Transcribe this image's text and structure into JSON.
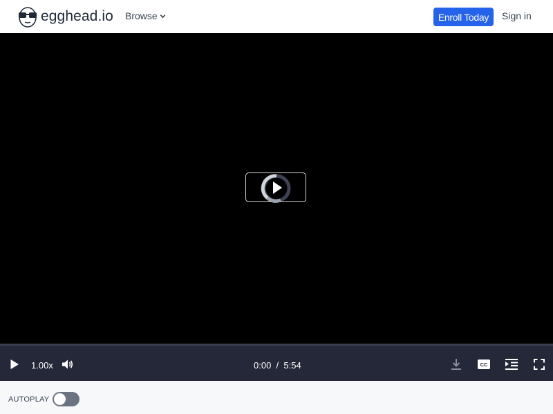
{
  "header": {
    "logo_text": "egghead.io",
    "logo_icon": "egghead-glasses-icon",
    "browse_label": "Browse",
    "enroll_label": "Enroll Today",
    "signin_label": "Sign in",
    "accent_color": "#2563eb"
  },
  "player": {
    "big_play_icon": "play-icon",
    "loading": true,
    "progress_fraction": 0,
    "speed": "1.00x",
    "current_time": "0:00",
    "time_separator": "/",
    "duration": "5:54",
    "icons": [
      "play-icon",
      "volume-icon",
      "download-icon",
      "closed-captions-icon",
      "playlist-icon",
      "fullscreen-icon"
    ]
  },
  "autoplay": {
    "label": "AUTOPLAY",
    "enabled": false
  }
}
